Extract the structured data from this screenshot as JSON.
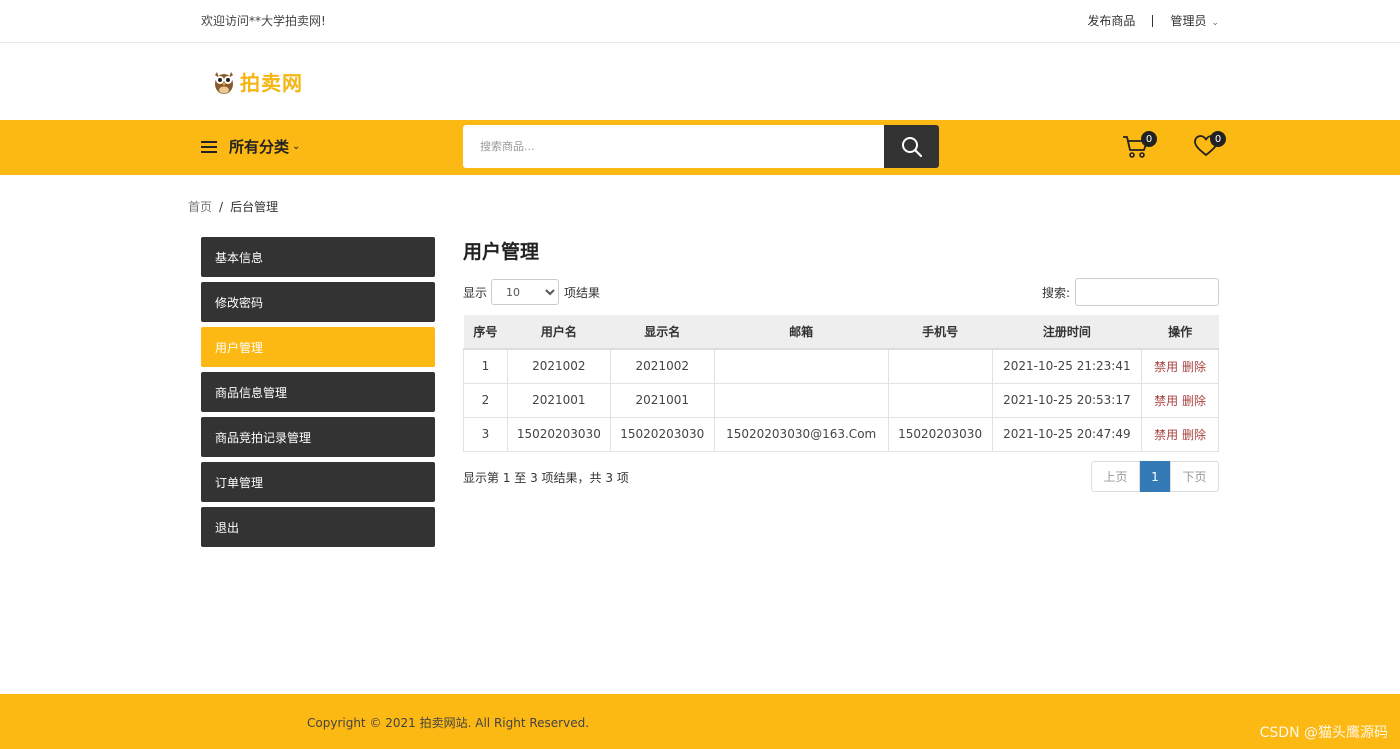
{
  "topbar": {
    "welcome": "欢迎访问**大学拍卖网!",
    "publish": "发布商品",
    "admin": "管理员"
  },
  "logo": {
    "text": "拍卖网"
  },
  "nav": {
    "all_categories": "所有分类",
    "search_placeholder": "搜索商品...",
    "cart_count": "0",
    "wishlist_count": "0"
  },
  "breadcrumb": {
    "home": "首页",
    "separator": "/",
    "current": "后台管理"
  },
  "sidebar": {
    "items": [
      {
        "label": "基本信息"
      },
      {
        "label": "修改密码"
      },
      {
        "label": "用户管理",
        "active": true
      },
      {
        "label": "商品信息管理"
      },
      {
        "label": "商品竞拍记录管理"
      },
      {
        "label": "订单管理"
      },
      {
        "label": "退出"
      }
    ]
  },
  "main": {
    "title": "用户管理",
    "length_prefix": "显示",
    "length_value": "10",
    "length_suffix": "项结果",
    "search_label": "搜索:",
    "search_value": "",
    "columns": [
      "序号",
      "用户名",
      "显示名",
      "邮箱",
      "手机号",
      "注册时间",
      "操作"
    ],
    "rows": [
      {
        "no": "1",
        "username": "2021002",
        "display": "2021002",
        "email": "",
        "phone": "",
        "time": "2021-10-25 21:23:41"
      },
      {
        "no": "2",
        "username": "2021001",
        "display": "2021001",
        "email": "",
        "phone": "",
        "time": "2021-10-25 20:53:17"
      },
      {
        "no": "3",
        "username": "15020203030",
        "display": "15020203030",
        "email": "15020203030@163.Com",
        "phone": "15020203030",
        "time": "2021-10-25 20:47:49"
      }
    ],
    "action_disable": "禁用",
    "action_delete": "删除",
    "info": "显示第 1 至 3 项结果，共 3 项",
    "pager": {
      "prev": "上页",
      "current": "1",
      "next": "下页"
    }
  },
  "footer": {
    "copyright": "Copyright © 2021 拍卖网站. All Right Reserved.",
    "watermark": "CSDN @猫头鹰源码"
  },
  "colors": {
    "accent": "#fcb813",
    "dark": "#333333",
    "link_red": "#a94442",
    "pager_blue": "#337ab7"
  }
}
